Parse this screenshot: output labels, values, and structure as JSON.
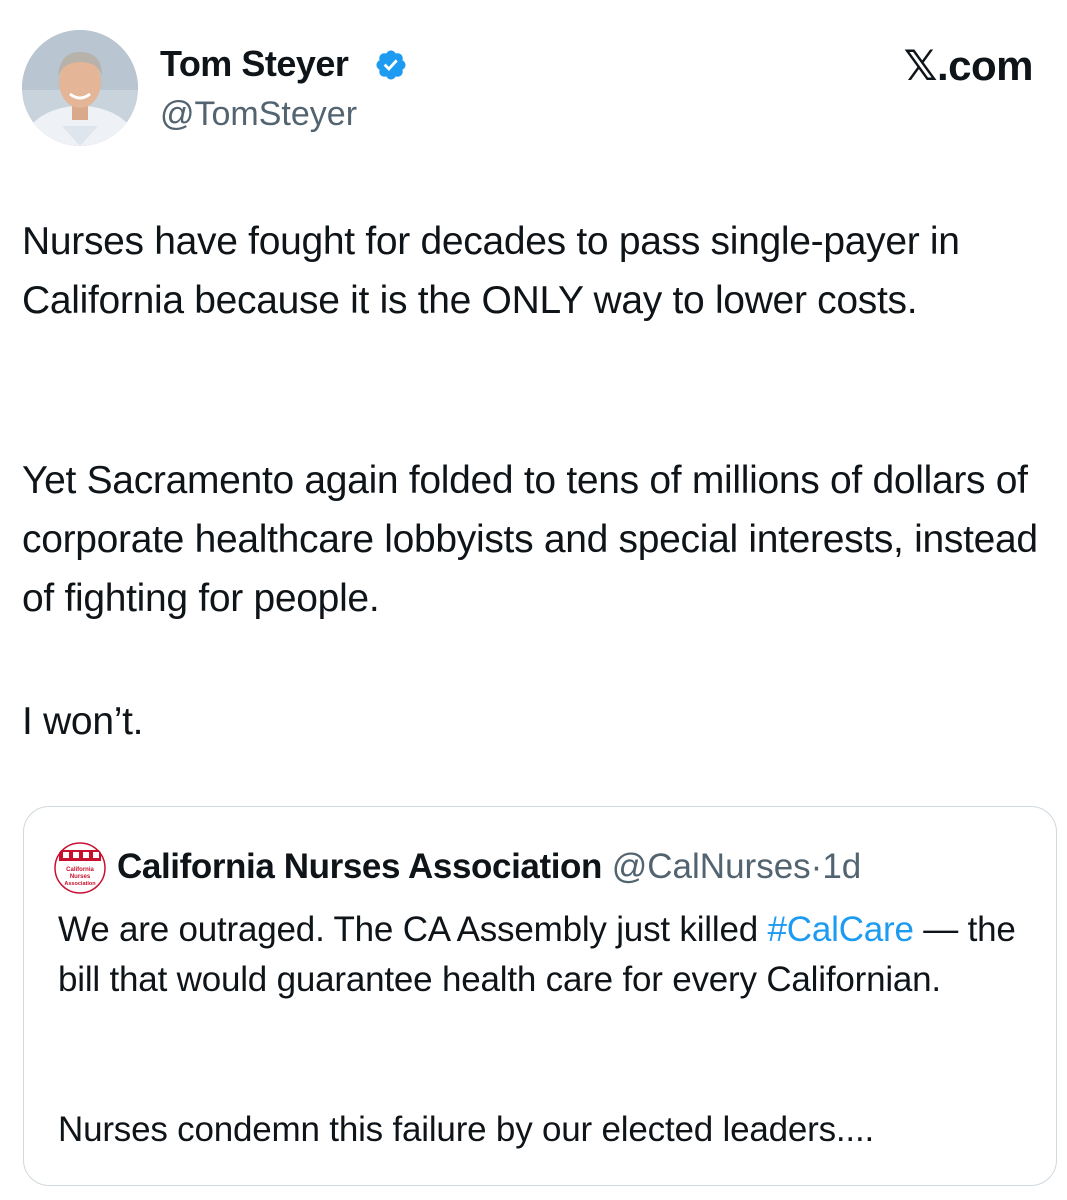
{
  "post": {
    "author_name": "Tom Steyer",
    "author_handle": "@TomSteyer",
    "verified": true,
    "brand_label_x": "𝕏",
    "brand_label_suffix": ".com",
    "paragraphs": [
      "Nurses have fought for decades to pass single-payer in California because it is the ONLY way to lower costs.",
      "Yet Sacramento again folded to tens of millions of dollars of corporate healthcare lobbyists and special interests, instead of fighting for people.",
      "I won’t."
    ]
  },
  "quoted_post": {
    "author_name": "California Nurses Association",
    "author_handle": "@CalNurses",
    "separator": "·",
    "time": "1d",
    "avatar_text": [
      "California",
      "Nurses",
      "Association"
    ],
    "para1_lead": "We are outraged. The CA Assembly just killed ",
    "hashtag": "#CalCare",
    "para1_rest": " — the bill that would guarantee health care for every Californian.",
    "para2": "Nurses condemn this failure by our elected leaders...."
  },
  "colors": {
    "text_primary": "#0f1419",
    "text_secondary": "#536471",
    "link": "#1d9bf0",
    "verified_badge": "#1d9bf0",
    "card_border": "#cfd9de",
    "cna_red": "#c8102e"
  }
}
